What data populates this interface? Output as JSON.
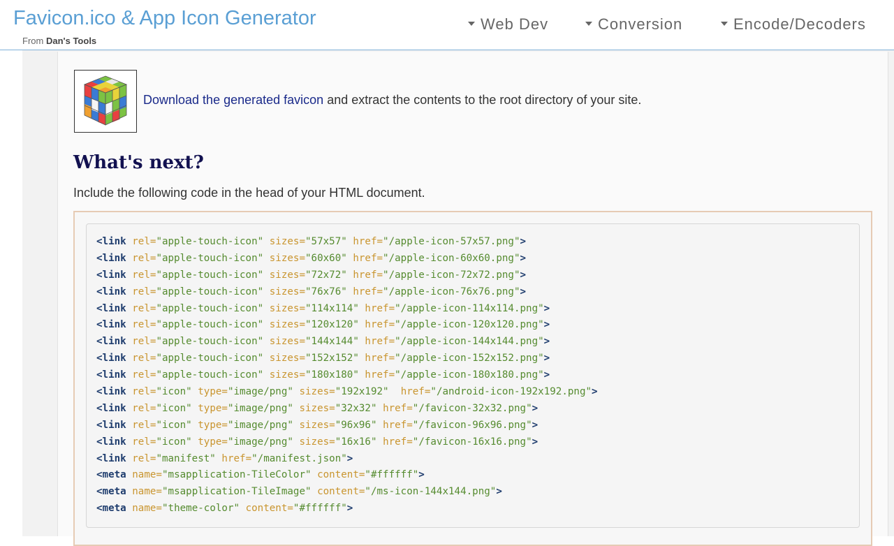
{
  "header": {
    "title": "Favicon.ico & App Icon Generator",
    "subtitle_prefix": "From",
    "subtitle_brand": "Dan's Tools",
    "nav": [
      {
        "label": "Web Dev"
      },
      {
        "label": "Conversion"
      },
      {
        "label": "Encode/Decoders"
      }
    ]
  },
  "result": {
    "icon_name": "rubiks-cube-icon",
    "download_link": "Download the generated favicon",
    "download_rest": " and extract the contents to the root directory of your site."
  },
  "next": {
    "heading": "What's next?",
    "intro": "Include the following code in the head of your HTML document."
  },
  "code": [
    [
      {
        "t": "tag",
        "v": "<link"
      },
      {
        "t": "sp",
        "v": " "
      },
      {
        "t": "attr",
        "v": "rel="
      },
      {
        "t": "val",
        "v": "\"apple-touch-icon\""
      },
      {
        "t": "sp",
        "v": " "
      },
      {
        "t": "attr",
        "v": "sizes="
      },
      {
        "t": "val",
        "v": "\"57x57\""
      },
      {
        "t": "sp",
        "v": " "
      },
      {
        "t": "attr",
        "v": "href="
      },
      {
        "t": "val",
        "v": "\"/apple-icon-57x57.png\""
      },
      {
        "t": "tag",
        "v": ">"
      }
    ],
    [
      {
        "t": "tag",
        "v": "<link"
      },
      {
        "t": "sp",
        "v": " "
      },
      {
        "t": "attr",
        "v": "rel="
      },
      {
        "t": "val",
        "v": "\"apple-touch-icon\""
      },
      {
        "t": "sp",
        "v": " "
      },
      {
        "t": "attr",
        "v": "sizes="
      },
      {
        "t": "val",
        "v": "\"60x60\""
      },
      {
        "t": "sp",
        "v": " "
      },
      {
        "t": "attr",
        "v": "href="
      },
      {
        "t": "val",
        "v": "\"/apple-icon-60x60.png\""
      },
      {
        "t": "tag",
        "v": ">"
      }
    ],
    [
      {
        "t": "tag",
        "v": "<link"
      },
      {
        "t": "sp",
        "v": " "
      },
      {
        "t": "attr",
        "v": "rel="
      },
      {
        "t": "val",
        "v": "\"apple-touch-icon\""
      },
      {
        "t": "sp",
        "v": " "
      },
      {
        "t": "attr",
        "v": "sizes="
      },
      {
        "t": "val",
        "v": "\"72x72\""
      },
      {
        "t": "sp",
        "v": " "
      },
      {
        "t": "attr",
        "v": "href="
      },
      {
        "t": "val",
        "v": "\"/apple-icon-72x72.png\""
      },
      {
        "t": "tag",
        "v": ">"
      }
    ],
    [
      {
        "t": "tag",
        "v": "<link"
      },
      {
        "t": "sp",
        "v": " "
      },
      {
        "t": "attr",
        "v": "rel="
      },
      {
        "t": "val",
        "v": "\"apple-touch-icon\""
      },
      {
        "t": "sp",
        "v": " "
      },
      {
        "t": "attr",
        "v": "sizes="
      },
      {
        "t": "val",
        "v": "\"76x76\""
      },
      {
        "t": "sp",
        "v": " "
      },
      {
        "t": "attr",
        "v": "href="
      },
      {
        "t": "val",
        "v": "\"/apple-icon-76x76.png\""
      },
      {
        "t": "tag",
        "v": ">"
      }
    ],
    [
      {
        "t": "tag",
        "v": "<link"
      },
      {
        "t": "sp",
        "v": " "
      },
      {
        "t": "attr",
        "v": "rel="
      },
      {
        "t": "val",
        "v": "\"apple-touch-icon\""
      },
      {
        "t": "sp",
        "v": " "
      },
      {
        "t": "attr",
        "v": "sizes="
      },
      {
        "t": "val",
        "v": "\"114x114\""
      },
      {
        "t": "sp",
        "v": " "
      },
      {
        "t": "attr",
        "v": "href="
      },
      {
        "t": "val",
        "v": "\"/apple-icon-114x114.png\""
      },
      {
        "t": "tag",
        "v": ">"
      }
    ],
    [
      {
        "t": "tag",
        "v": "<link"
      },
      {
        "t": "sp",
        "v": " "
      },
      {
        "t": "attr",
        "v": "rel="
      },
      {
        "t": "val",
        "v": "\"apple-touch-icon\""
      },
      {
        "t": "sp",
        "v": " "
      },
      {
        "t": "attr",
        "v": "sizes="
      },
      {
        "t": "val",
        "v": "\"120x120\""
      },
      {
        "t": "sp",
        "v": " "
      },
      {
        "t": "attr",
        "v": "href="
      },
      {
        "t": "val",
        "v": "\"/apple-icon-120x120.png\""
      },
      {
        "t": "tag",
        "v": ">"
      }
    ],
    [
      {
        "t": "tag",
        "v": "<link"
      },
      {
        "t": "sp",
        "v": " "
      },
      {
        "t": "attr",
        "v": "rel="
      },
      {
        "t": "val",
        "v": "\"apple-touch-icon\""
      },
      {
        "t": "sp",
        "v": " "
      },
      {
        "t": "attr",
        "v": "sizes="
      },
      {
        "t": "val",
        "v": "\"144x144\""
      },
      {
        "t": "sp",
        "v": " "
      },
      {
        "t": "attr",
        "v": "href="
      },
      {
        "t": "val",
        "v": "\"/apple-icon-144x144.png\""
      },
      {
        "t": "tag",
        "v": ">"
      }
    ],
    [
      {
        "t": "tag",
        "v": "<link"
      },
      {
        "t": "sp",
        "v": " "
      },
      {
        "t": "attr",
        "v": "rel="
      },
      {
        "t": "val",
        "v": "\"apple-touch-icon\""
      },
      {
        "t": "sp",
        "v": " "
      },
      {
        "t": "attr",
        "v": "sizes="
      },
      {
        "t": "val",
        "v": "\"152x152\""
      },
      {
        "t": "sp",
        "v": " "
      },
      {
        "t": "attr",
        "v": "href="
      },
      {
        "t": "val",
        "v": "\"/apple-icon-152x152.png\""
      },
      {
        "t": "tag",
        "v": ">"
      }
    ],
    [
      {
        "t": "tag",
        "v": "<link"
      },
      {
        "t": "sp",
        "v": " "
      },
      {
        "t": "attr",
        "v": "rel="
      },
      {
        "t": "val",
        "v": "\"apple-touch-icon\""
      },
      {
        "t": "sp",
        "v": " "
      },
      {
        "t": "attr",
        "v": "sizes="
      },
      {
        "t": "val",
        "v": "\"180x180\""
      },
      {
        "t": "sp",
        "v": " "
      },
      {
        "t": "attr",
        "v": "href="
      },
      {
        "t": "val",
        "v": "\"/apple-icon-180x180.png\""
      },
      {
        "t": "tag",
        "v": ">"
      }
    ],
    [
      {
        "t": "tag",
        "v": "<link"
      },
      {
        "t": "sp",
        "v": " "
      },
      {
        "t": "attr",
        "v": "rel="
      },
      {
        "t": "val",
        "v": "\"icon\""
      },
      {
        "t": "sp",
        "v": " "
      },
      {
        "t": "attr",
        "v": "type="
      },
      {
        "t": "val",
        "v": "\"image/png\""
      },
      {
        "t": "sp",
        "v": " "
      },
      {
        "t": "attr",
        "v": "sizes="
      },
      {
        "t": "val",
        "v": "\"192x192\""
      },
      {
        "t": "sp",
        "v": "  "
      },
      {
        "t": "attr",
        "v": "href="
      },
      {
        "t": "val",
        "v": "\"/android-icon-192x192.png\""
      },
      {
        "t": "tag",
        "v": ">"
      }
    ],
    [
      {
        "t": "tag",
        "v": "<link"
      },
      {
        "t": "sp",
        "v": " "
      },
      {
        "t": "attr",
        "v": "rel="
      },
      {
        "t": "val",
        "v": "\"icon\""
      },
      {
        "t": "sp",
        "v": " "
      },
      {
        "t": "attr",
        "v": "type="
      },
      {
        "t": "val",
        "v": "\"image/png\""
      },
      {
        "t": "sp",
        "v": " "
      },
      {
        "t": "attr",
        "v": "sizes="
      },
      {
        "t": "val",
        "v": "\"32x32\""
      },
      {
        "t": "sp",
        "v": " "
      },
      {
        "t": "attr",
        "v": "href="
      },
      {
        "t": "val",
        "v": "\"/favicon-32x32.png\""
      },
      {
        "t": "tag",
        "v": ">"
      }
    ],
    [
      {
        "t": "tag",
        "v": "<link"
      },
      {
        "t": "sp",
        "v": " "
      },
      {
        "t": "attr",
        "v": "rel="
      },
      {
        "t": "val",
        "v": "\"icon\""
      },
      {
        "t": "sp",
        "v": " "
      },
      {
        "t": "attr",
        "v": "type="
      },
      {
        "t": "val",
        "v": "\"image/png\""
      },
      {
        "t": "sp",
        "v": " "
      },
      {
        "t": "attr",
        "v": "sizes="
      },
      {
        "t": "val",
        "v": "\"96x96\""
      },
      {
        "t": "sp",
        "v": " "
      },
      {
        "t": "attr",
        "v": "href="
      },
      {
        "t": "val",
        "v": "\"/favicon-96x96.png\""
      },
      {
        "t": "tag",
        "v": ">"
      }
    ],
    [
      {
        "t": "tag",
        "v": "<link"
      },
      {
        "t": "sp",
        "v": " "
      },
      {
        "t": "attr",
        "v": "rel="
      },
      {
        "t": "val",
        "v": "\"icon\""
      },
      {
        "t": "sp",
        "v": " "
      },
      {
        "t": "attr",
        "v": "type="
      },
      {
        "t": "val",
        "v": "\"image/png\""
      },
      {
        "t": "sp",
        "v": " "
      },
      {
        "t": "attr",
        "v": "sizes="
      },
      {
        "t": "val",
        "v": "\"16x16\""
      },
      {
        "t": "sp",
        "v": " "
      },
      {
        "t": "attr",
        "v": "href="
      },
      {
        "t": "val",
        "v": "\"/favicon-16x16.png\""
      },
      {
        "t": "tag",
        "v": ">"
      }
    ],
    [
      {
        "t": "tag",
        "v": "<link"
      },
      {
        "t": "sp",
        "v": " "
      },
      {
        "t": "attr",
        "v": "rel="
      },
      {
        "t": "val",
        "v": "\"manifest\""
      },
      {
        "t": "sp",
        "v": " "
      },
      {
        "t": "attr",
        "v": "href="
      },
      {
        "t": "val",
        "v": "\"/manifest.json\""
      },
      {
        "t": "tag",
        "v": ">"
      }
    ],
    [
      {
        "t": "tag",
        "v": "<meta"
      },
      {
        "t": "sp",
        "v": " "
      },
      {
        "t": "attr",
        "v": "name="
      },
      {
        "t": "val",
        "v": "\"msapplication-TileColor\""
      },
      {
        "t": "sp",
        "v": " "
      },
      {
        "t": "attr",
        "v": "content="
      },
      {
        "t": "val",
        "v": "\"#ffffff\""
      },
      {
        "t": "tag",
        "v": ">"
      }
    ],
    [
      {
        "t": "tag",
        "v": "<meta"
      },
      {
        "t": "sp",
        "v": " "
      },
      {
        "t": "attr",
        "v": "name="
      },
      {
        "t": "val",
        "v": "\"msapplication-TileImage\""
      },
      {
        "t": "sp",
        "v": " "
      },
      {
        "t": "attr",
        "v": "content="
      },
      {
        "t": "val",
        "v": "\"/ms-icon-144x144.png\""
      },
      {
        "t": "tag",
        "v": ">"
      }
    ],
    [
      {
        "t": "tag",
        "v": "<meta"
      },
      {
        "t": "sp",
        "v": " "
      },
      {
        "t": "attr",
        "v": "name="
      },
      {
        "t": "val",
        "v": "\"theme-color\""
      },
      {
        "t": "sp",
        "v": " "
      },
      {
        "t": "attr",
        "v": "content="
      },
      {
        "t": "val",
        "v": "\"#ffffff\""
      },
      {
        "t": "tag",
        "v": ">"
      }
    ]
  ]
}
